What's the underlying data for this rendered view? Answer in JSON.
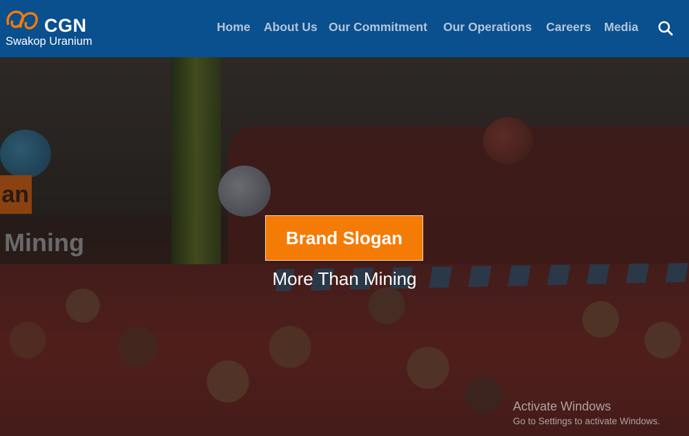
{
  "header": {
    "logo_brand": "CGN",
    "logo_sub": "Swakop Uranium",
    "nav": [
      {
        "label": "Home"
      },
      {
        "label": "About Us"
      },
      {
        "label": "Our Commitment"
      },
      {
        "label": "Our Operations"
      },
      {
        "label": "Careers"
      },
      {
        "label": "Media"
      }
    ],
    "search_icon": "search-icon"
  },
  "hero": {
    "slogan_title": "Brand Slogan",
    "slogan_subtitle": "More Than Mining",
    "side_tag_fragment": "an",
    "side_text_fragment": "Mining"
  },
  "system": {
    "activate_title": "Activate Windows",
    "activate_sub": "Go to Settings to activate Windows."
  },
  "colors": {
    "header_bg": "#0a4f8e",
    "accent": "#f47b06",
    "nav_text": "#b5c6da"
  }
}
